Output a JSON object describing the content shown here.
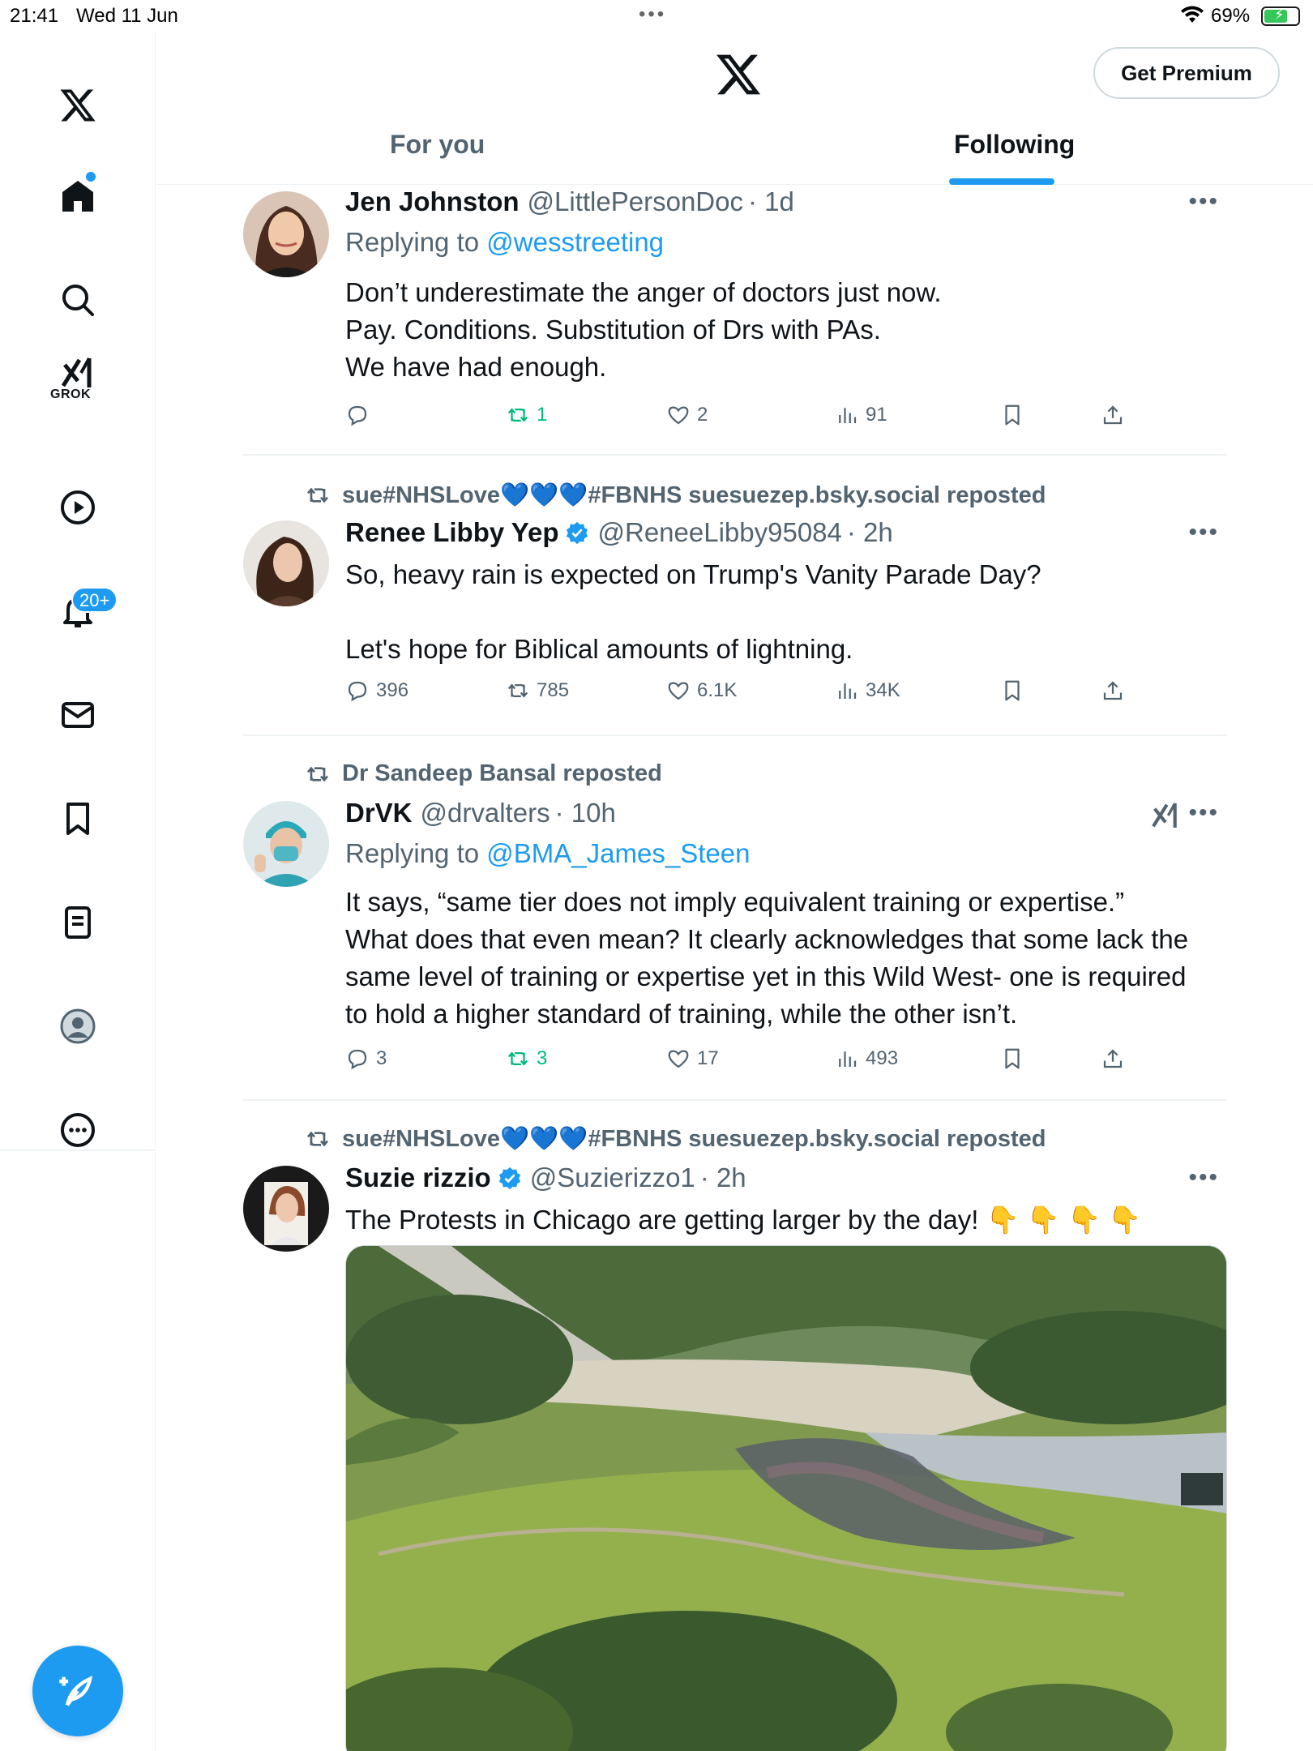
{
  "status_bar": {
    "time": "21:41",
    "date": "Wed 11 Jun",
    "battery_percent": "69%",
    "battery_level": 0.69,
    "charging": true
  },
  "sidebar": {
    "items": [
      {
        "name": "home",
        "icon": "home-icon",
        "active": true
      },
      {
        "name": "search",
        "icon": "search-icon"
      },
      {
        "name": "grok",
        "icon": "grok-icon",
        "label": "GROK"
      },
      {
        "name": "video",
        "icon": "play-icon"
      },
      {
        "name": "notifications",
        "icon": "bell-icon",
        "badge": "20+"
      },
      {
        "name": "messages",
        "icon": "mail-icon"
      },
      {
        "name": "bookmarks",
        "icon": "bookmark-icon"
      },
      {
        "name": "lists",
        "icon": "list-icon"
      },
      {
        "name": "profile",
        "icon": "profile-icon"
      },
      {
        "name": "more",
        "icon": "more-circle-icon"
      }
    ],
    "grok_label": "GROK",
    "notifications_badge": "20+"
  },
  "header": {
    "premium_button": "Get Premium",
    "tabs": [
      {
        "label": "For you",
        "active": false
      },
      {
        "label": "Following",
        "active": true
      }
    ]
  },
  "colors": {
    "accent": "#1d9bf0",
    "text_primary": "#0f1419",
    "text_secondary": "#536471",
    "repost_green": "#00ba7c"
  },
  "tweets": [
    {
      "name": "Jen Johnston",
      "handle": "@LittlePersonDoc",
      "time": "· 1d",
      "reply_prefix": "Replying to",
      "reply_mention": "@wesstreeting",
      "lines": [
        "Don’t underestimate the anger of doctors just now.",
        "Pay. Conditions. Substitution of Drs with PAs.",
        "We have had enough."
      ],
      "replies": "",
      "reposts": "1",
      "likes": "2",
      "views": "91"
    },
    {
      "reposted_by": "sue#NHSLove💙💙💙#FBNHS suesuezep.bsky.social reposted",
      "name": "Renee Libby Yep",
      "verified": true,
      "handle": "@ReneeLibby95084",
      "time": "· 2h",
      "lines": [
        "So, heavy rain is expected on Trump's Vanity Parade Day?",
        "",
        "Let's hope for Biblical amounts of lightning."
      ],
      "replies": "396",
      "reposts": "785",
      "likes": "6.1K",
      "views": "34K"
    },
    {
      "reposted_by": "Dr Sandeep Bansal reposted",
      "name": "DrVK",
      "handle": "@drvalters",
      "time": "· 10h",
      "reply_prefix": "Replying to",
      "reply_mention": "@BMA_James_Steen",
      "lines": [
        "It says, “same tier does not imply equivalent training or expertise.”",
        "What does that even mean? It clearly acknowledges that some lack the",
        "same level of training or expertise yet in this Wild West- one is required",
        "to hold a higher standard of training, while the other isn’t."
      ],
      "replies": "3",
      "reposts": "3",
      "likes": "17",
      "views": "493"
    },
    {
      "reposted_by": "sue#NHSLove💙💙💙#FBNHS suesuezep.bsky.social reposted",
      "name": "Suzie rizzio",
      "verified": true,
      "handle": "@Suzierizzo1",
      "time": "· 2h",
      "lines": [
        "The Protests in Chicago are getting larger by the day! 👇 👇 👇 👇"
      ]
    }
  ]
}
